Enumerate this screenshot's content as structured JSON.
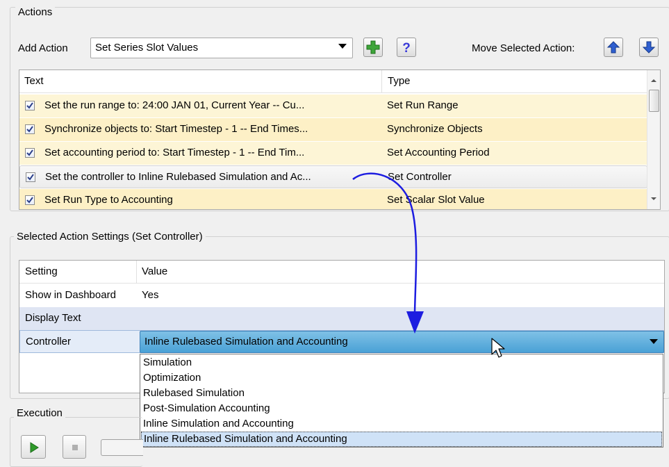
{
  "actions_group": {
    "title": "Actions",
    "add_action_label": "Add Action",
    "add_action_value": "Set Series Slot Values",
    "move_label": "Move Selected Action:",
    "table": {
      "headers": [
        "Text",
        "Type"
      ],
      "rows": [
        {
          "text": "Set the run range to: 24:00 JAN 01, Current Year -- Cu...",
          "type": "Set Run Range",
          "checked": true
        },
        {
          "text": "Synchronize objects to: Start Timestep - 1 -- End Times...",
          "type": "Synchronize Objects",
          "checked": true
        },
        {
          "text": "Set accounting period to: Start Timestep - 1 -- End Tim...",
          "type": "Set Accounting Period",
          "checked": true
        },
        {
          "text": "Set the controller to Inline Rulebased Simulation and Ac...",
          "type": "Set Controller",
          "checked": true,
          "selected": true
        },
        {
          "text": "Set Run Type to Accounting",
          "type": "Set Scalar Slot Value",
          "checked": true
        }
      ]
    }
  },
  "settings_group": {
    "title": "Selected Action Settings (Set Controller)",
    "headers": [
      "Setting",
      "Value"
    ],
    "rows": [
      {
        "setting": "Show in Dashboard",
        "value": "Yes"
      },
      {
        "setting": "Display Text",
        "value": ""
      },
      {
        "setting": "Controller",
        "value": "Inline Rulebased Simulation and Accounting"
      }
    ],
    "controller_options": [
      "Simulation",
      "Optimization",
      "Rulebased Simulation",
      "Post-Simulation Accounting",
      "Inline Simulation and Accounting",
      "Inline Rulebased Simulation and Accounting"
    ],
    "selected_option": "Inline Rulebased Simulation and Accounting"
  },
  "execution_group": {
    "title": "Execution"
  },
  "colors": {
    "row_highlight": "#fdf5d6",
    "selected_row": "#f3f3f3",
    "annotation_arrow": "#1d1de0",
    "add_icon": "#3ea53a",
    "help_icon": "#3a3ad8",
    "move_icon": "#2f5fd0",
    "play_icon": "#2f9a2a"
  },
  "icons": [
    "dropdown-arrow-icon",
    "add-icon",
    "help-icon",
    "move-up-icon",
    "move-down-icon",
    "checkbox-check-icon",
    "play-icon",
    "stop-icon",
    "mouse-cursor-icon"
  ]
}
